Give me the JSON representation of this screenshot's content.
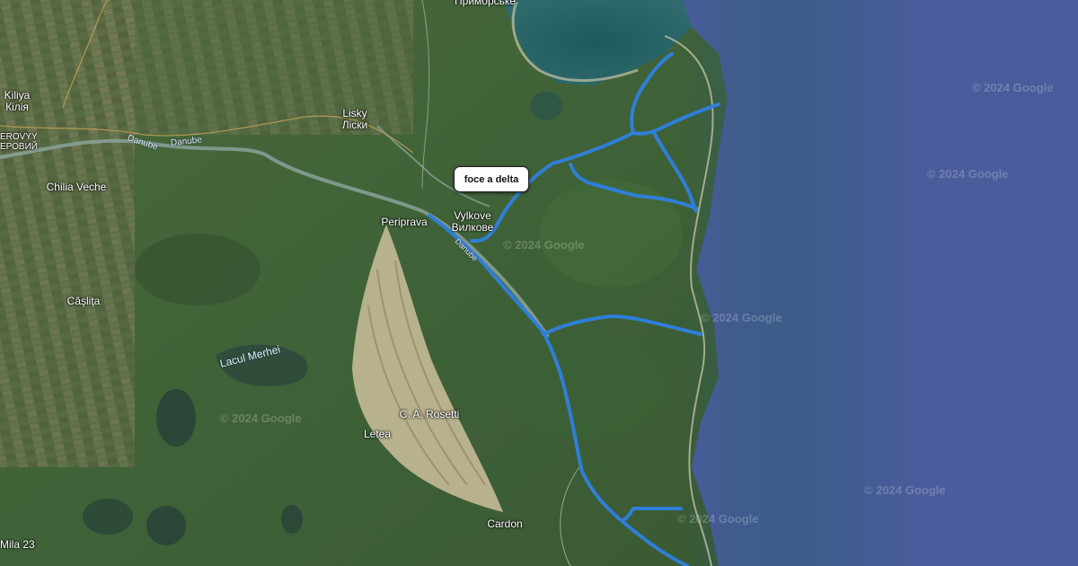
{
  "map": {
    "basemap": "satellite",
    "route_color": "#2f7fd8",
    "sea_color": "#4a5c9c"
  },
  "callout": {
    "label": "foce a delta"
  },
  "places": {
    "primorske": "Приморське",
    "kiliya_lat": "Kiliya",
    "kiliya_cyr": "Кілія",
    "nerovyy_lat": "EROVYY",
    "nerovyy_cyr": "ЕРОВИЙ",
    "lisky_lat": "Lisky",
    "lisky_cyr": "Ліски",
    "chilia_veche": "Chilia Veche",
    "periprava": "Periprava",
    "vylkove_lat": "Vylkove",
    "vylkove_cyr": "Вилкове",
    "caslita": "Câşliţa",
    "lacul_merhei": "Lacul Merhei",
    "ca_rosetti": "C. A. Rosetti",
    "letea": "Letea",
    "cardon": "Cardon",
    "mila_23": "Mila 23"
  },
  "rivers": {
    "danube_1": "Danube",
    "danube_2": "Danube",
    "danube_3": "Danube"
  },
  "watermark": "© 2024 Google"
}
